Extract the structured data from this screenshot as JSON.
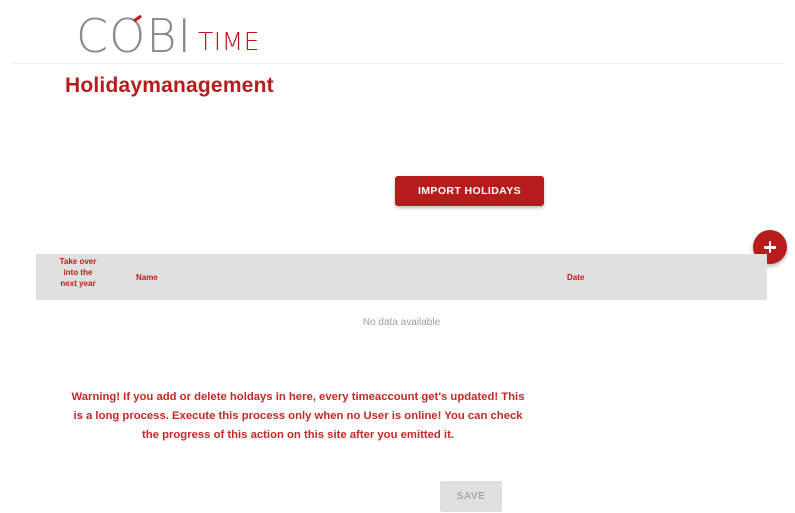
{
  "logo": {
    "main": "COBI",
    "sub": "TIME"
  },
  "page": {
    "title": "Holidaymanagement"
  },
  "actions": {
    "import_label": "IMPORT HOLIDAYS",
    "add_icon": "plus-icon",
    "save_label": "SAVE"
  },
  "table": {
    "columns": [
      "Take over\ninto the\nnext year",
      "Name",
      "Date"
    ],
    "rows": [],
    "empty_text": "No data available"
  },
  "warning": {
    "lines": [
      "Warning! If you add or delete holdays in here, every timeaccount get's updated! This",
      "is a long process. Execute this process only when no User is online! You can check",
      "the progress of this action on this site after you emitted it."
    ]
  },
  "colors": {
    "accent": "#b71c1c",
    "table_header_bg": "#e0e0e0",
    "disabled_bg": "#e0e0e0",
    "disabled_text": "#a8a8a8",
    "logo_gray": "#8a8a8a"
  }
}
